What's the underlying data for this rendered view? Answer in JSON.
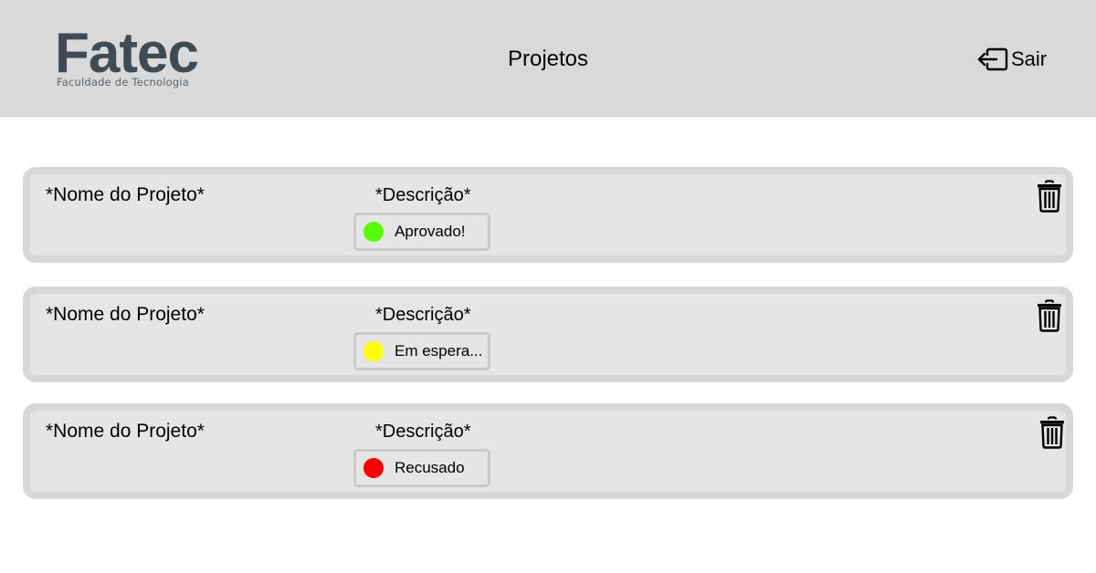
{
  "header": {
    "logo_text": "Fatec",
    "logo_subtitle": "Faculdade de Tecnologia",
    "title": "Projetos",
    "logout_label": "Sair",
    "logout_icon": "logout-arrow-icon",
    "background": "#d9d9d9"
  },
  "projects": [
    {
      "name": "*Nome do Projeto*",
      "description": "*Descrição*",
      "status": "Aprovado!",
      "status_color": "#55ff00",
      "delete_icon": "trash-icon"
    },
    {
      "name": "*Nome do Projeto*",
      "description": "*Descrição*",
      "status": "Em espera...",
      "status_color": "#ffff00",
      "delete_icon": "trash-icon"
    },
    {
      "name": "*Nome do Projeto*",
      "description": "*Descrição*",
      "status": "Recusado",
      "status_color": "#ff0000",
      "delete_icon": "trash-icon"
    }
  ]
}
